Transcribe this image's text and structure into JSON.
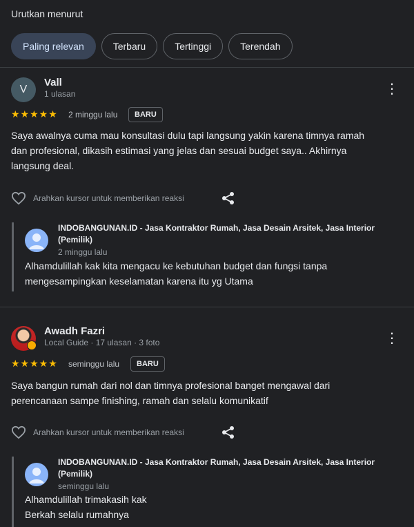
{
  "sort": {
    "label": "Urutkan menurut",
    "options": [
      "Paling relevan",
      "Terbaru",
      "Tertinggi",
      "Terendah"
    ],
    "selected": "Paling relevan"
  },
  "reviews": [
    {
      "avatar_letter": "V",
      "author": "Vall",
      "meta": "1 ulasan",
      "rating": 5,
      "stars": "★★★★★",
      "date": "2 minggu lalu",
      "badge": "BARU",
      "text_lines": [
        "Saya awalnya cuma mau konsultasi dulu tapi langsung yakin karena timnya ramah",
        "dan profesional, dikasih estimasi yang jelas dan sesuai budget saya.. Akhirnya",
        "langsung deal."
      ],
      "reaction_hint": "Arahkan kursor untuk memberikan reaksi",
      "owner_reply": {
        "name_lines": [
          "INDOBANGUNAN.ID - Jasa Kontraktor Rumah, Jasa Desain Arsitek, Jasa Interior",
          "(Pemilik)"
        ],
        "date": "2 minggu lalu",
        "text_lines": [
          "Alhamdulillah kak kita mengacu ke kebutuhan budget dan fungsi tanpa",
          "mengesampingkan keselamatan karena itu yg Utama"
        ]
      }
    },
    {
      "author": "Awadh Fazri",
      "meta": "Local Guide · 17 ulasan · 3 foto",
      "rating": 5,
      "stars": "★★★★★",
      "date": "seminggu lalu",
      "badge": "BARU",
      "text_lines": [
        "Saya bangun rumah dari nol dan timnya profesional banget mengawal dari",
        "perencanaan sampe finishing, ramah dan selalu komunikatif"
      ],
      "reaction_hint": "Arahkan kursor untuk memberikan reaksi",
      "owner_reply": {
        "name_lines": [
          "INDOBANGUNAN.ID - Jasa Kontraktor Rumah, Jasa Desain Arsitek, Jasa Interior",
          "(Pemilik)"
        ],
        "date": "seminggu lalu",
        "text_lines": [
          "Alhamdulillah trimakasih kak",
          "Berkah selalu rumahnya"
        ]
      }
    }
  ]
}
